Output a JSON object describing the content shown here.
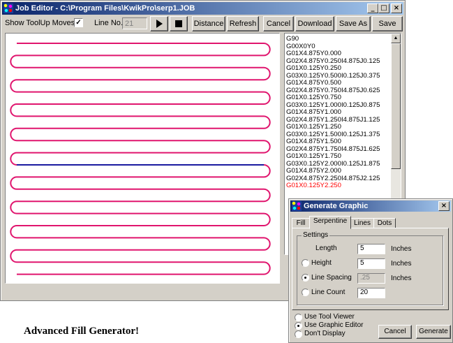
{
  "window": {
    "title": "Job Editor - C:\\Program Files\\KwikPro\\serp1.JOB",
    "minimize": "_",
    "maximize": "□",
    "close": "×"
  },
  "toolbar": {
    "show_toolup_label": "Show ToolUp Moves",
    "show_toolup_checked": "✓",
    "line_no_label": "Line No.",
    "line_no_value": "21",
    "play_icon": "play-icon",
    "stop_icon": "stop-icon",
    "distance": "Distance",
    "refresh": "Refresh",
    "cancel": "Cancel",
    "download": "Download",
    "save_as": "Save As",
    "save": "Save"
  },
  "code": {
    "lines": [
      "G90",
      "G00X0Y0",
      "G01X4.875Y0.000",
      "G02X4.875Y0.250I4.875J0.125",
      "G01X0.125Y0.250",
      "G03X0.125Y0.500I0.125J0.375",
      "G01X4.875Y0.500",
      "G02X4.875Y0.750I4.875J0.625",
      "G01X0.125Y0.750",
      "G03X0.125Y1.000I0.125J0.875",
      "G01X4.875Y1.000",
      "G02X4.875Y1.250I4.875J1.125",
      "G01X0.125Y1.250",
      "G03X0.125Y1.500I0.125J1.375",
      "G01X4.875Y1.500",
      "G02X4.875Y1.750I4.875J1.625",
      "G01X0.125Y1.750",
      "G03X0.125Y2.000I0.125J1.875",
      "G01X4.875Y2.000",
      "G02X4.875Y2.250I4.875J2.125",
      "G01X0.125Y2.250"
    ],
    "highlighted_index": 20
  },
  "preview": {
    "path_color": "#e0156e",
    "current_color": "#1a1aa0",
    "passes": 20,
    "current_pass": 10
  },
  "caption": "Advanced Fill Generator!",
  "dialog": {
    "title": "Generate Graphic",
    "close": "×",
    "tabs": [
      "Fill",
      "Serpentine",
      "Lines",
      "Dots"
    ],
    "active_tab": "Serpentine",
    "settings_label": "Settings",
    "length_label": "Length",
    "length_value": "5",
    "length_unit": "Inches",
    "height_label": "Height",
    "height_value": "5",
    "height_unit": "Inches",
    "spacing_label": "Line Spacing",
    "spacing_value": ".25",
    "spacing_unit": "Inches",
    "count_label": "Line Count",
    "count_value": "20",
    "selected_mode": "Line Spacing",
    "use_tool_viewer": "Use Tool Viewer",
    "use_graphic_editor": "Use Graphic Editor",
    "dont_display": "Don't Display",
    "selected_output": "Use Graphic Editor",
    "cancel": "Cancel",
    "generate": "Generate"
  }
}
